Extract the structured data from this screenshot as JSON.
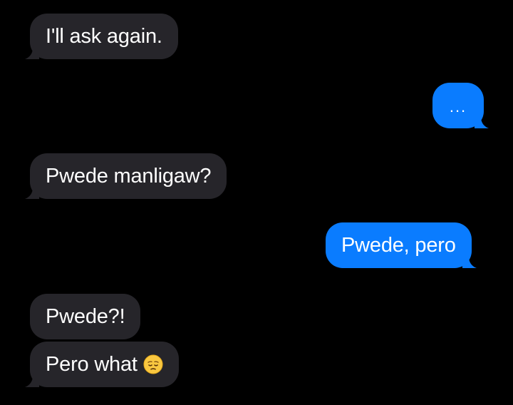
{
  "conversation": {
    "messages": [
      {
        "direction": "received",
        "text": "I'll ask again."
      },
      {
        "direction": "sent",
        "text": "..."
      },
      {
        "direction": "received",
        "text": "Pwede manligaw?"
      },
      {
        "direction": "sent",
        "text": "Pwede, pero"
      },
      {
        "direction": "received",
        "text": "Pwede?!"
      },
      {
        "direction": "received",
        "text": "Pero what",
        "emoji": "pensive-face-emoji"
      }
    ]
  },
  "colors": {
    "background": "#000000",
    "received_bubble": "#26252a",
    "sent_bubble": "#0a7cff",
    "text": "#ffffff"
  }
}
